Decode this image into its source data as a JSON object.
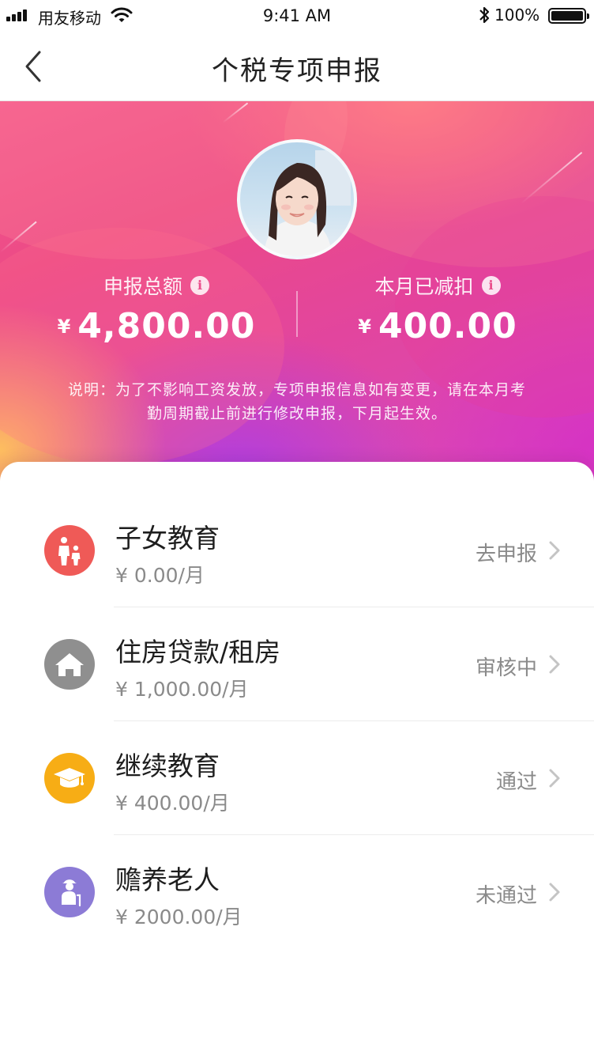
{
  "status_bar": {
    "carrier": "用友移动",
    "time": "9:41 AM",
    "battery_percent": "100%"
  },
  "nav": {
    "title": "个税专项申报"
  },
  "summary": {
    "total": {
      "label": "申报总额",
      "currency": "¥",
      "value": "4,800.00"
    },
    "deducted": {
      "label": "本月已减扣",
      "currency": "¥",
      "value": "400.00"
    },
    "note": "说明：为了不影响工资发放，专项申报信息如有变更，请在本月考勤周期截止前进行修改申报，下月起生效。"
  },
  "items": [
    {
      "title": "子女教育",
      "amount": "¥ 0.00/月",
      "status": "去申报",
      "icon": "children-icon",
      "color": "#ef5a57"
    },
    {
      "title": "住房贷款/租房",
      "amount": "¥ 1,000.00/月",
      "status": "审核中",
      "icon": "house-icon",
      "color": "#8f8f8f"
    },
    {
      "title": "继续教育",
      "amount": "¥ 400.00/月",
      "status": "通过",
      "icon": "graduation-cap-icon",
      "color": "#f7ad15"
    },
    {
      "title": "赡养老人",
      "amount": "¥ 2000.00/月",
      "status": "未通过",
      "icon": "elder-icon",
      "color": "#8c7bd6"
    }
  ]
}
